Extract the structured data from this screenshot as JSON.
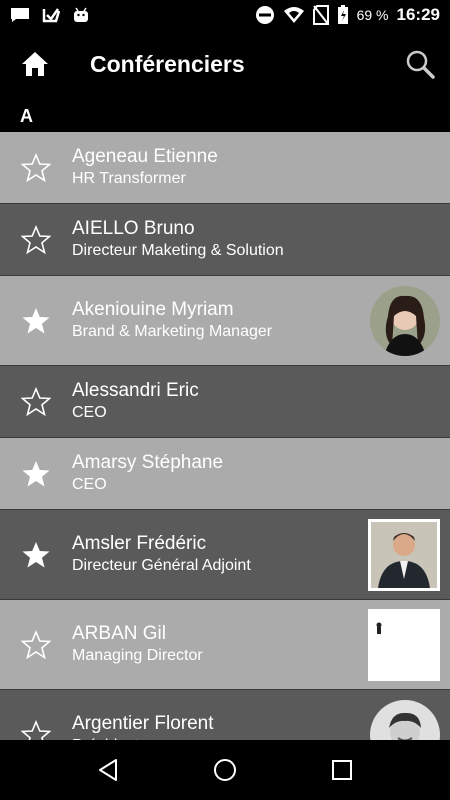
{
  "status_bar": {
    "battery_percent": "69 %",
    "time": "16:29",
    "icons": [
      "message-icon",
      "check-icon",
      "android-icon",
      "dnd-icon",
      "wifi-icon",
      "no-sim-icon",
      "battery-icon"
    ]
  },
  "app_bar": {
    "title": "Conférenciers",
    "home_icon": "home-icon",
    "search_icon": "search-icon"
  },
  "section": {
    "letter": "A"
  },
  "speakers": [
    {
      "name": "Ageneau Etienne",
      "role": "HR Transformer",
      "favorite": false,
      "photo": "none"
    },
    {
      "name": "AIELLO Bruno",
      "role": "Directeur Maketing & Solution",
      "favorite": false,
      "photo": "none"
    },
    {
      "name": "Akeniouine Myriam",
      "role": "Brand & Marketing Manager",
      "favorite": true,
      "photo": "round"
    },
    {
      "name": "Alessandri Eric",
      "role": "CEO",
      "favorite": false,
      "photo": "none"
    },
    {
      "name": "Amarsy Stéphane",
      "role": "CEO",
      "favorite": true,
      "photo": "none"
    },
    {
      "name": "Amsler Frédéric",
      "role": "Directeur Général Adjoint",
      "favorite": true,
      "photo": "square"
    },
    {
      "name": "ARBAN Gil",
      "role": "Managing Director",
      "favorite": false,
      "photo": "square-white"
    },
    {
      "name": "Argentier Florent",
      "role": "Président",
      "favorite": false,
      "photo": "round"
    }
  ],
  "colors": {
    "row_light": "#ababab",
    "row_dark": "#5a5a5a",
    "bar_background": "#000000"
  }
}
